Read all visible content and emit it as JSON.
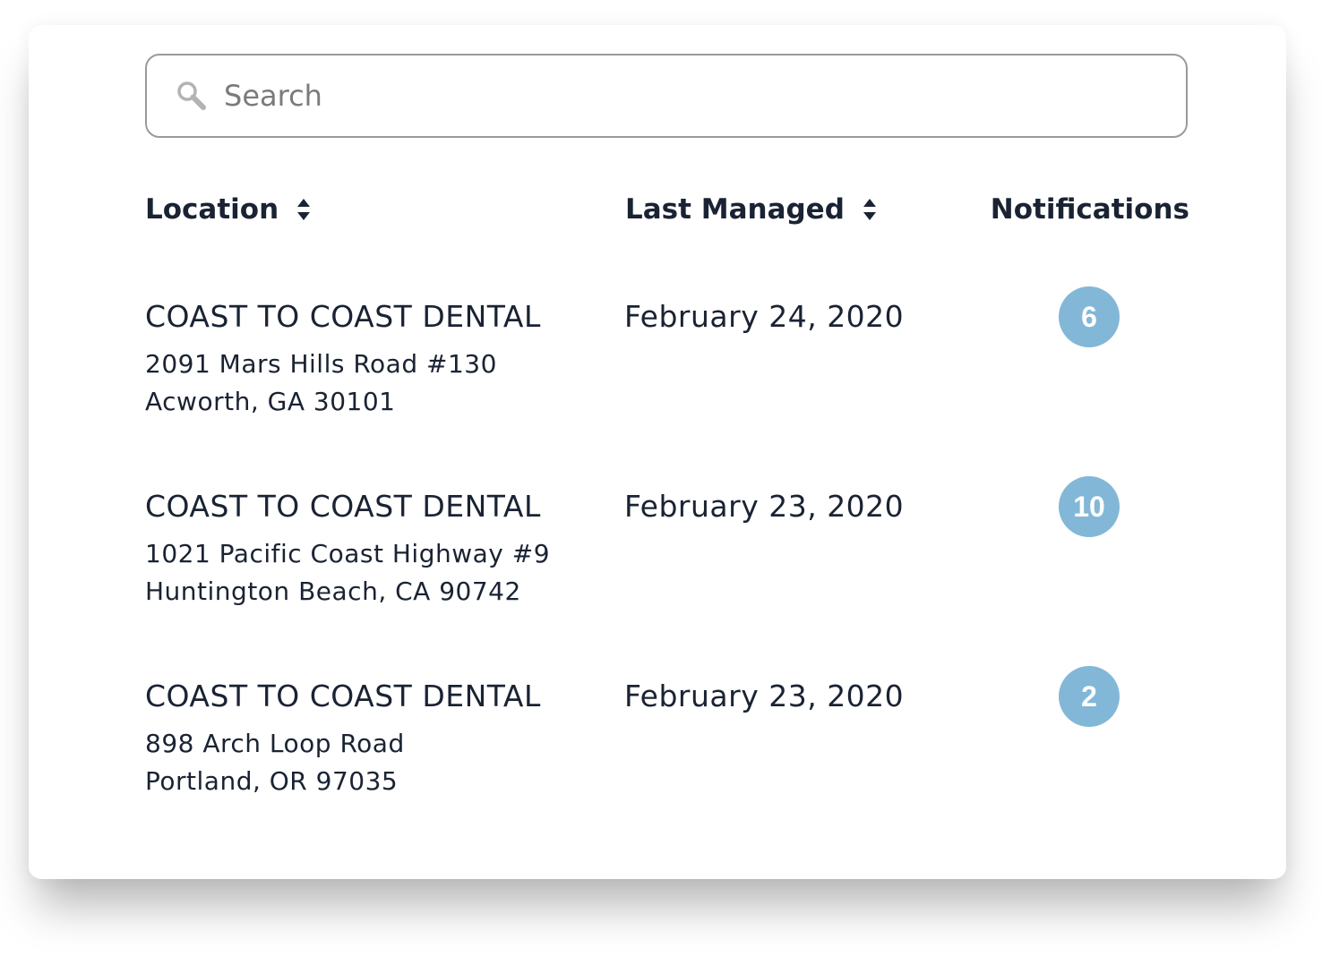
{
  "search": {
    "placeholder": "Search",
    "icon": "search-icon"
  },
  "table": {
    "columns": [
      {
        "label": "Location",
        "sortable": true
      },
      {
        "label": "Last Managed",
        "sortable": true
      },
      {
        "label": "Notifications",
        "sortable": false
      }
    ],
    "rows": [
      {
        "name": "COAST TO COAST DENTAL",
        "address_line1": "2091 Mars Hills Road #130",
        "address_line2": "Acworth, GA 30101",
        "last_managed": "February 24, 2020",
        "notifications": "6"
      },
      {
        "name": "COAST TO COAST DENTAL",
        "address_line1": "1021 Pacific Coast Highway #9",
        "address_line2": "Huntington Beach, CA 90742",
        "last_managed": "February 23, 2020",
        "notifications": "10"
      },
      {
        "name": "COAST TO COAST DENTAL",
        "address_line1": "898 Arch Loop Road",
        "address_line2": "Portland, OR 97035",
        "last_managed": "February 23, 2020",
        "notifications": "2"
      }
    ]
  },
  "colors": {
    "text": "#1a2333",
    "badge": "#83b7d7",
    "border": "#9a9a9a"
  }
}
